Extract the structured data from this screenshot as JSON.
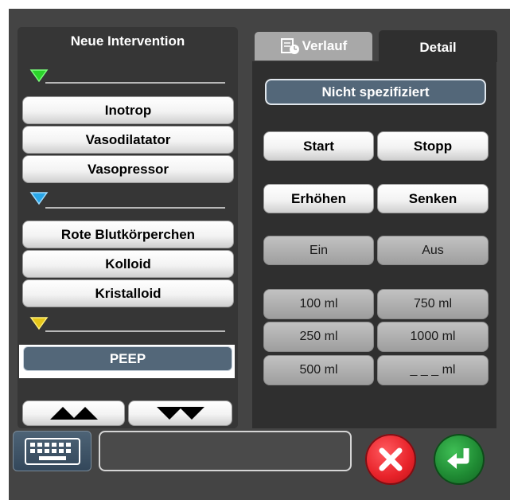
{
  "left_panel": {
    "title": "Neue Intervention",
    "group_green": [
      "Inotrop",
      "Vasodilatator",
      "Vasopressor"
    ],
    "group_blue": [
      "Rote Blutkörperchen",
      "Kolloid",
      "Kristalloid"
    ],
    "group_yellow_selected": "PEEP"
  },
  "tabs": {
    "verlauf": "Verlauf",
    "detail": "Detail"
  },
  "detail": {
    "selected": "Nicht spezifiziert",
    "start": "Start",
    "stopp": "Stopp",
    "erhoehen": "Erhöhen",
    "senken": "Senken",
    "ein": "Ein",
    "aus": "Aus",
    "volumes": [
      "100 ml",
      "750 ml",
      "250 ml",
      "1000 ml",
      "500 ml",
      "_ _ _ ml"
    ]
  },
  "colors": {
    "green_marker": "#2bd42b",
    "blue_marker": "#29a6e8",
    "yellow_marker": "#e6c619",
    "cancel": "#e8232a",
    "confirm": "#1f8a33",
    "selected_button": "#536779"
  },
  "icons": {
    "scroll_up": "double-up-arrow-icon",
    "scroll_down": "double-down-arrow-icon",
    "keyboard": "keyboard-icon",
    "cancel": "x-icon",
    "confirm": "enter-icon",
    "history": "history-document-icon"
  }
}
